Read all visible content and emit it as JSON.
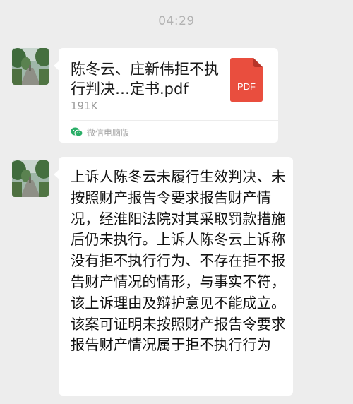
{
  "status": {
    "time": "04:29"
  },
  "messages": [
    {
      "type": "file",
      "file": {
        "name": "陈冬云、庄新伟拒不执行判决…定书.pdf",
        "size": "191K",
        "icon_label": "PDF",
        "icon_color": "#e94e3e"
      },
      "source": "微信电脑版",
      "icon": "wechat-icon"
    },
    {
      "type": "text",
      "text": "上诉人陈冬云未履行生效判决、未按照财产报告令要求报告财产情况，经淮阳法院对其采取罚款措施后仍未执行。上诉人陈冬云上诉称没有拒不执行行为、不存在拒不报告财产情况的情形，与事实不符，该上诉理由及辩护意见不能成立。该案可证明未按照财产报告令要求报告财产情况属于拒不执行行为"
    }
  ],
  "colors": {
    "background": "#ededed",
    "bubble": "#ffffff",
    "wechat_green": "#2aae67"
  }
}
